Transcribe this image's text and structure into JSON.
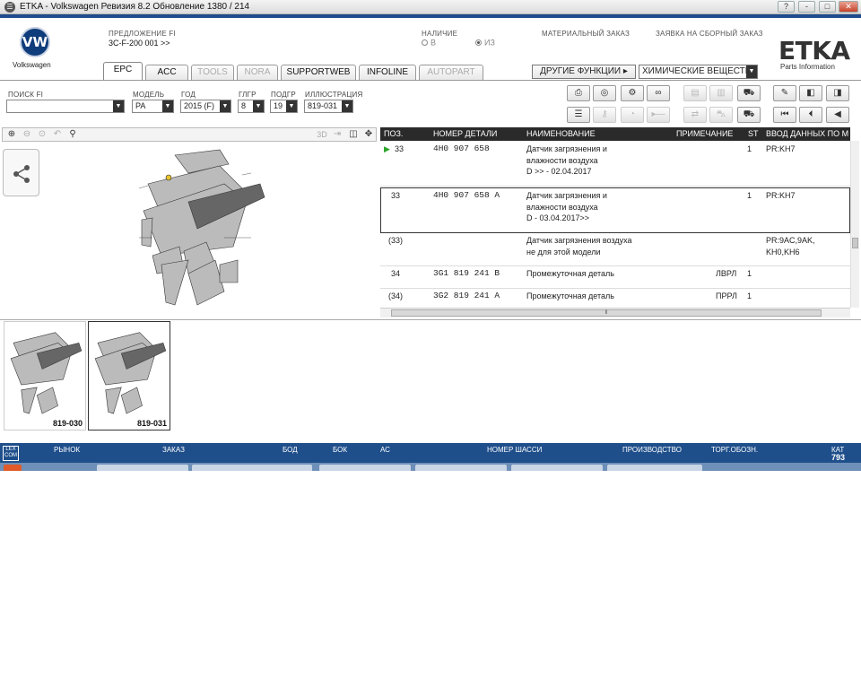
{
  "window": {
    "title": "ETKA - Volkswagen Ревизия 8.2 Обновление 1380 / 214",
    "controls": [
      "?",
      "-",
      "□",
      "✕"
    ]
  },
  "brand": {
    "vw_text": "Volkswagen",
    "etka_logo": "ETKA",
    "etka_sub": "Parts Information"
  },
  "header": {
    "fi_proposal_label": "ПРЕДЛОЖЕНИЕ FI",
    "fi_proposal_value": "3C-F-200 001 >>",
    "availability_label": "НАЛИЧИЕ",
    "availability_options": [
      {
        "label": "В",
        "selected": false
      },
      {
        "label": "ИЗ",
        "selected": true
      }
    ],
    "material_order_label": "МАТЕРИАЛЬНЫЙ ЗАКАЗ",
    "assembly_order_label": "ЗАЯВКА НА СБОРНЫЙ ЗАКАЗ"
  },
  "tabs": [
    {
      "label": "EPC",
      "active": true,
      "enabled": true
    },
    {
      "label": "ACC",
      "active": false,
      "enabled": true
    },
    {
      "label": "TOOLS",
      "active": false,
      "enabled": false
    },
    {
      "label": "NORA",
      "active": false,
      "enabled": false
    },
    {
      "label": "SUPPORTWEB",
      "active": false,
      "enabled": true
    },
    {
      "label": "INFOLINE",
      "active": false,
      "enabled": true
    },
    {
      "label": "AUTOPART",
      "active": false,
      "enabled": false
    }
  ],
  "other_functions_label": "ДРУГИЕ ФУНКЦИИ ▸",
  "chem_select_value": "ХИМИЧЕСКИЕ ВЕЩЕСТВА",
  "filters": {
    "search_fi_label": "ПОИСК FI",
    "search_fi_value": "",
    "model_label": "МОДЕЛЬ",
    "model_value": "PA",
    "year_label": "ГОД",
    "year_value": "2015 (F)",
    "main_group_label": "ГЛГР",
    "main_group_value": "8",
    "sub_group_label": "ПОДГР",
    "sub_group_value": "19",
    "illustration_label": "ИЛЛЮСТРАЦИЯ",
    "illustration_value": "819-031"
  },
  "zoom_toolbar": {
    "three_d_label": "3D"
  },
  "parts_table": {
    "columns": [
      "ПОЗ.",
      "НОМЕР ДЕТАЛИ",
      "НАИМЕНОВАНИЕ",
      "ПРИМЕЧАНИЕ",
      "ST",
      "ВВОД ДАННЫХ ПО М"
    ],
    "rows": [
      {
        "pos": "33",
        "part_no": "4H0  907  658",
        "name": [
          "Датчик загрязнения и",
          "влажности воздуха",
          "D             >> - 02.04.2017"
        ],
        "note": "",
        "st": "1",
        "data": [
          "PR:KH7"
        ],
        "marker": true,
        "selected": false
      },
      {
        "pos": "33",
        "part_no": "4H0  907  658  A",
        "name": [
          "Датчик загрязнения и",
          "влажности воздуха",
          "D - 03.04.2017>>"
        ],
        "note": "",
        "st": "1",
        "data": [
          "PR:KH7"
        ],
        "marker": false,
        "selected": true
      },
      {
        "pos": "(33)",
        "part_no": "",
        "name": [
          "Датчик загрязнения воздуха",
          "не для этой модели"
        ],
        "note": "",
        "st": "",
        "data": [
          "PR:9AC,9AK,",
          "KH0,KH6"
        ],
        "marker": false,
        "selected": false
      },
      {
        "pos": "34",
        "part_no": "3G1  819  241  B",
        "name": [
          "Промежуточная деталь"
        ],
        "note": "ЛВРЛ",
        "st": "1",
        "data": [],
        "marker": false,
        "selected": false
      },
      {
        "pos": "(34)",
        "part_no": "3G2  819  241  A",
        "name": [
          "Промежуточная деталь"
        ],
        "note": "ПРРЛ",
        "st": "1",
        "data": [],
        "marker": false,
        "selected": false
      }
    ]
  },
  "thumbnails": [
    {
      "label": "819-030",
      "selected": false
    },
    {
      "label": "819-031",
      "selected": true
    }
  ],
  "status_bar": {
    "logo": "LEX COM",
    "market_label": "РЫНОК",
    "order_label": "ЗАКАЗ",
    "bod_label": "БОД",
    "bok_label": "БОК",
    "ac_label": "АС",
    "chassis_label": "НОМЕР ШАССИ",
    "production_label": "ПРОИЗВОДСТВО",
    "trade_label": "ТОРГ.ОБОЗН.",
    "cat_label": "КАТ",
    "cat_value": "793"
  },
  "colors": {
    "brand_blue": "#1f4f8b",
    "header_dark": "#2a2a2a",
    "marker_green": "#2aa52a",
    "vw_blue": "#0f3c7a"
  }
}
